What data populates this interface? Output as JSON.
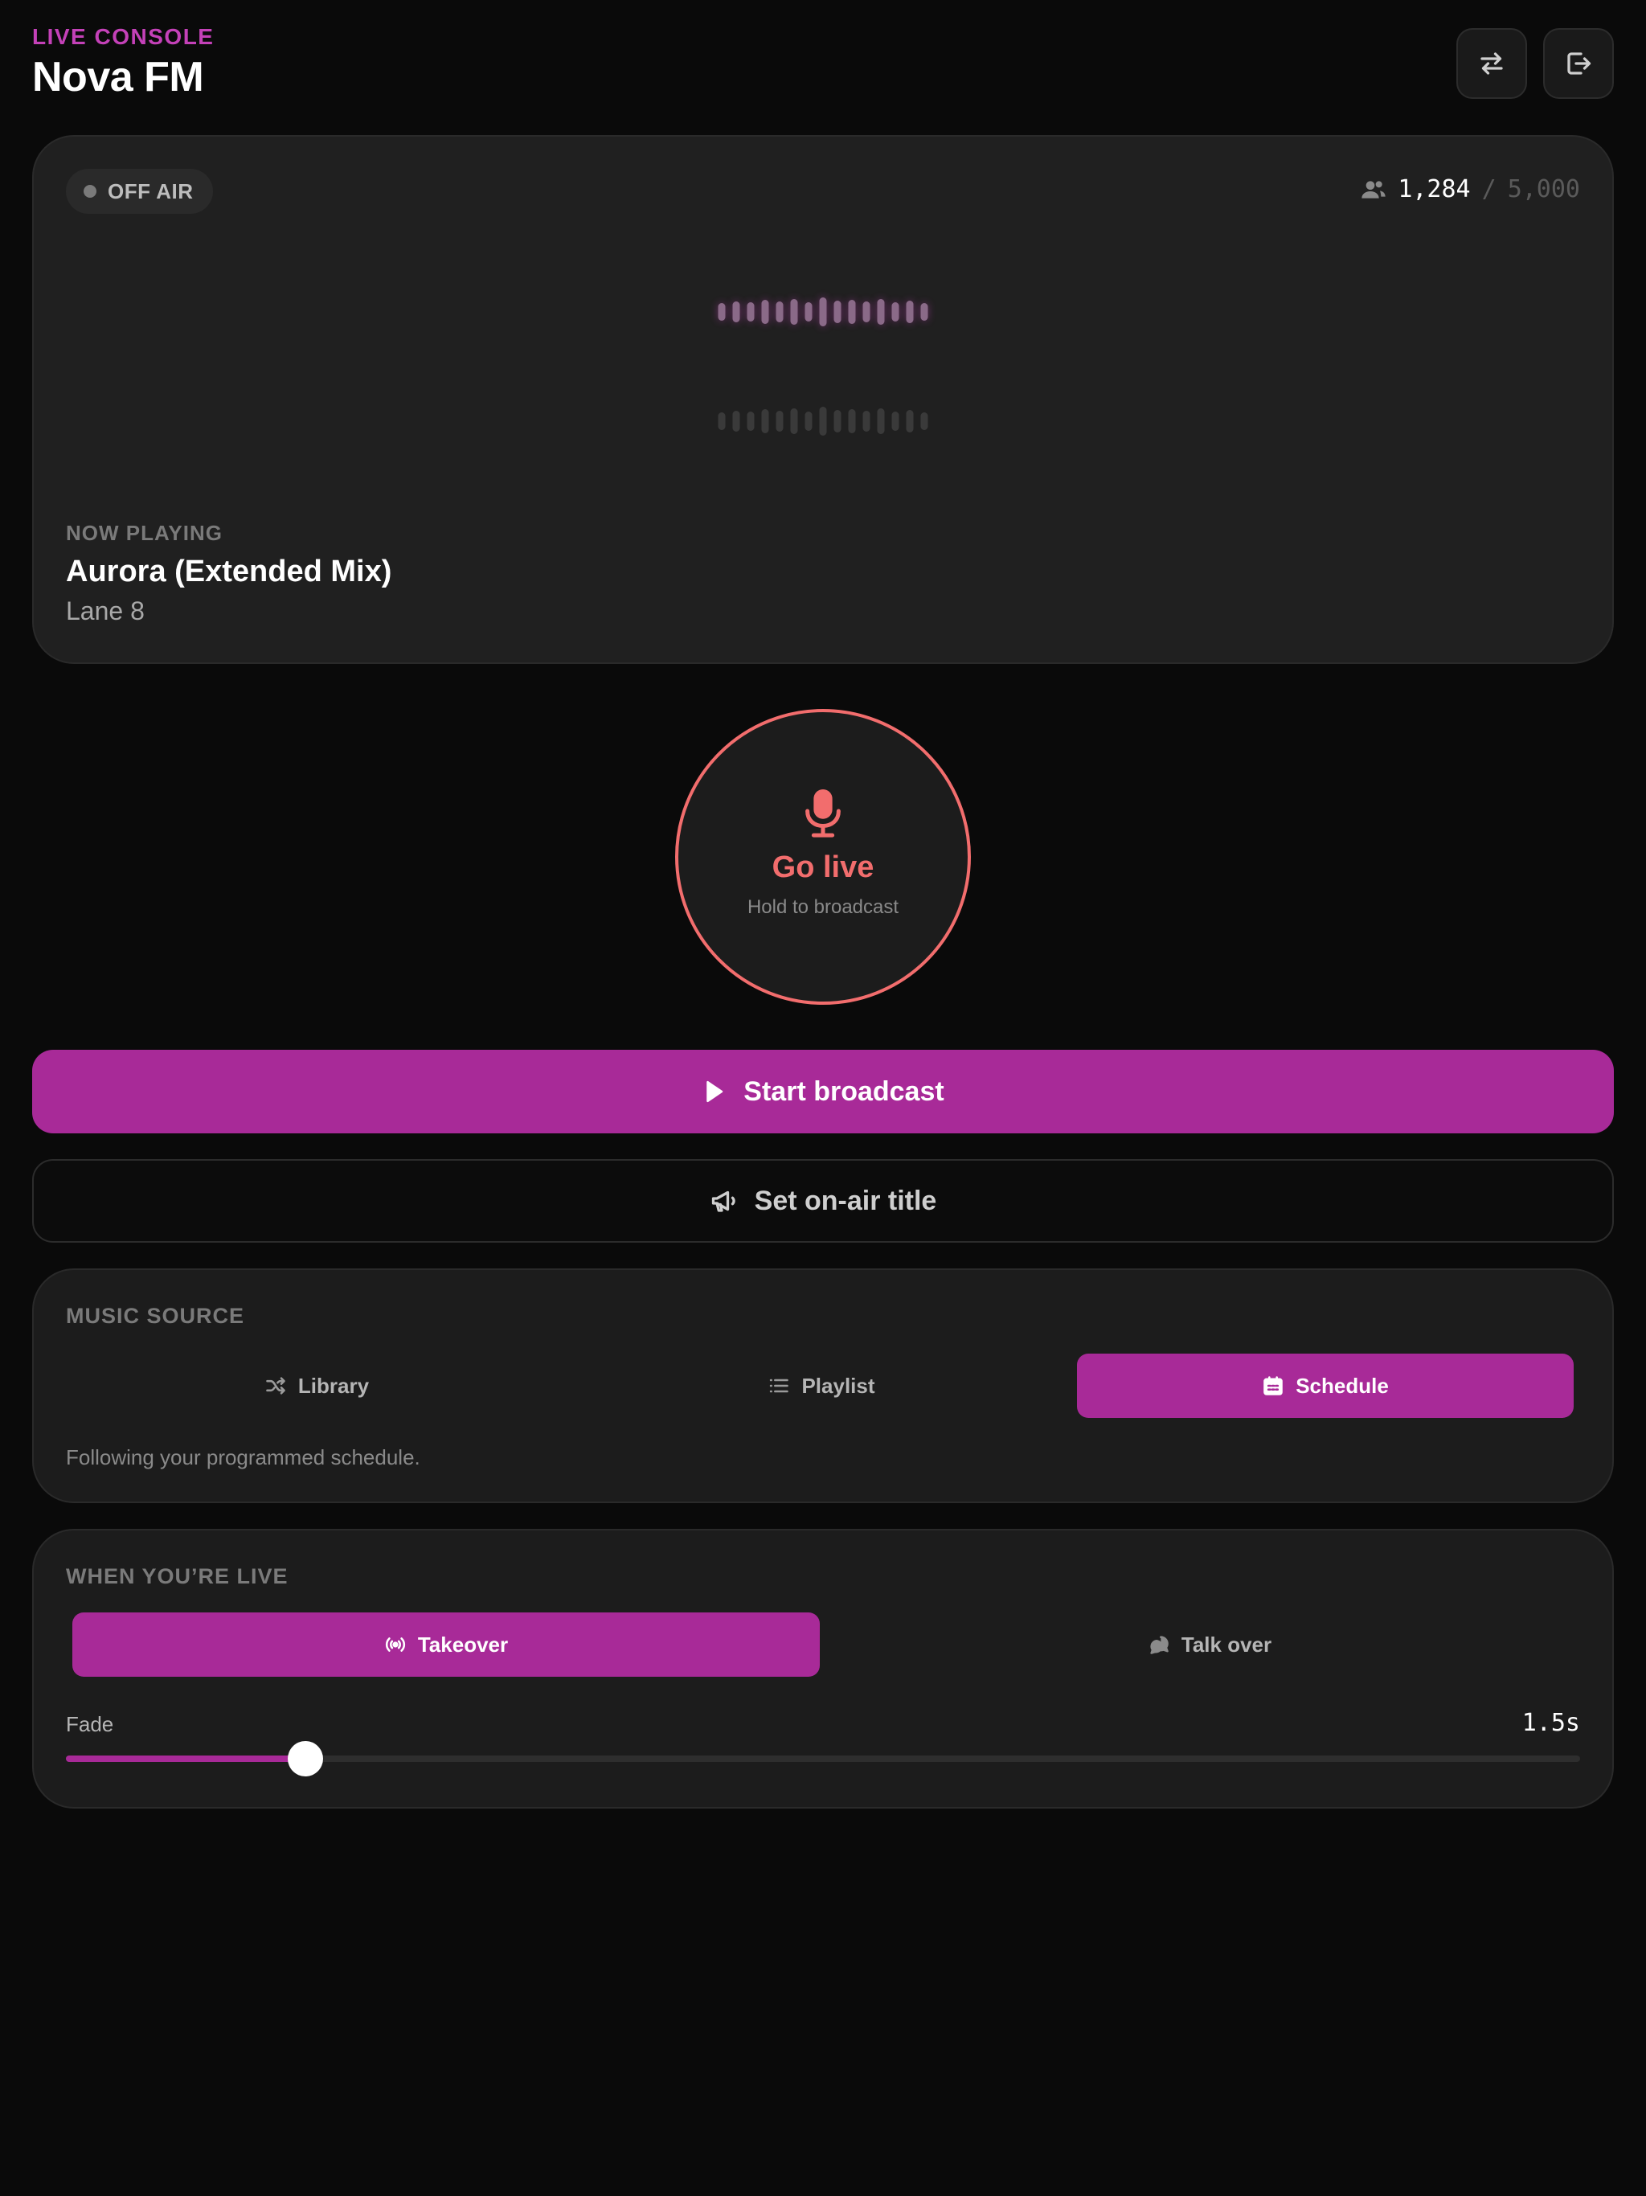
{
  "header": {
    "kicker": "LIVE CONSOLE",
    "station": "Nova FM",
    "buttons": [
      {
        "icon": "swap-arrows-icon"
      },
      {
        "icon": "logout-icon"
      }
    ]
  },
  "hero": {
    "status": "OFF AIR",
    "listeners": {
      "count": "1,284",
      "separator": "/",
      "max": "5,000",
      "icon": "users-icon"
    },
    "now_playing": {
      "label": "NOW PLAYING",
      "title": "Aurora (Extended Mix)",
      "artist": "Lane 8"
    }
  },
  "go_live": {
    "label": "Go live",
    "sublabel": "Hold to broadcast",
    "icon": "microphone-icon",
    "color": "#f26d6d"
  },
  "actions": {
    "start_broadcast": "Start broadcast",
    "set_title": "Set on-air title"
  },
  "music_source": {
    "title": "MUSIC SOURCE",
    "options": [
      {
        "label": "Library",
        "icon": "shuffle-icon",
        "active": false
      },
      {
        "label": "Playlist",
        "icon": "list-icon",
        "active": false
      },
      {
        "label": "Schedule",
        "icon": "calendar-icon",
        "active": true
      }
    ],
    "note": "Following your programmed schedule."
  },
  "when_live": {
    "title": "WHEN YOU’RE LIVE",
    "modes": [
      {
        "label": "Takeover",
        "icon": "broadcast-icon",
        "active": true
      },
      {
        "label": "Talk over",
        "icon": "chat-bubbles-icon",
        "active": false
      }
    ],
    "fade": {
      "label": "Fade",
      "value_text": "1.5s",
      "fraction": 0.158
    }
  },
  "colors": {
    "accent": "#a82a98",
    "accent_text": "#c441b8",
    "live_red": "#f26d6d",
    "background": "#0a0a0a"
  }
}
